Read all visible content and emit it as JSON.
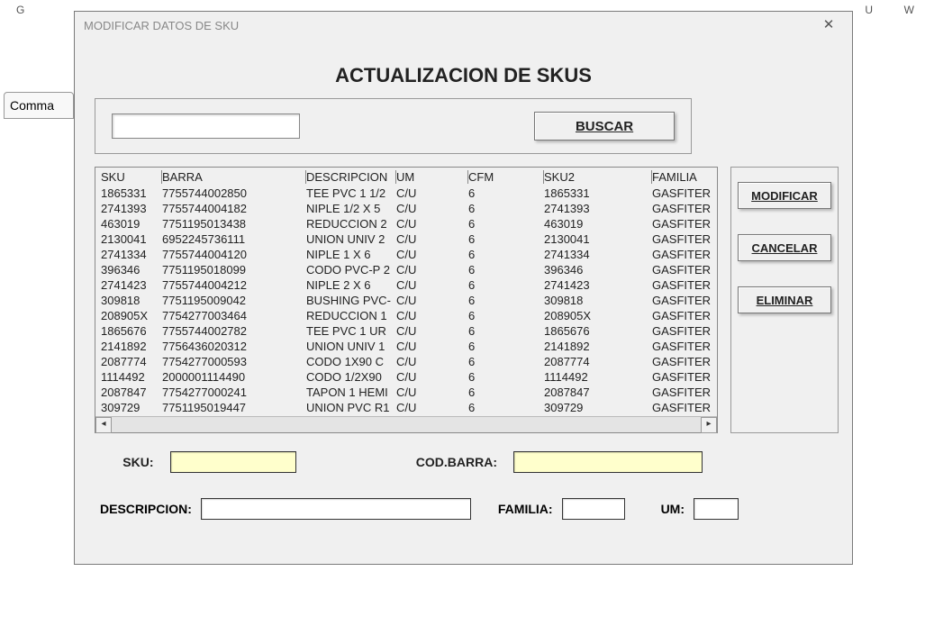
{
  "sheet": {
    "col_g": "G",
    "col_u": "U",
    "col_w": "W",
    "behind_button": "Comma"
  },
  "dialog": {
    "title": "MODIFICAR DATOS DE SKU",
    "heading": "ACTUALIZACION DE SKUS",
    "buscar": "BUSCAR",
    "side": {
      "modificar": "MODIFICAR",
      "cancelar": "CANCELAR",
      "eliminar": "ELIMINAR"
    },
    "grid": {
      "headers": {
        "sku": "SKU",
        "barra": "BARRA",
        "descripcion": "DESCRIPCION",
        "um": "UM",
        "cfm": "CFM",
        "sku2": "SKU2",
        "familia": "FAMILIA"
      },
      "rows": [
        {
          "sku": "1865331",
          "barra": "7755744002850",
          "desc": "TEE PVC 1 1/2",
          "um": "C/U",
          "cfm": "6",
          "sku2": "1865331",
          "fam": "GASFITER"
        },
        {
          "sku": "2741393",
          "barra": "7755744004182",
          "desc": "NIPLE 1/2 X 5",
          "um": "C/U",
          "cfm": "6",
          "sku2": "2741393",
          "fam": "GASFITER"
        },
        {
          "sku": "463019",
          "barra": "7751195013438",
          "desc": "REDUCCION 2",
          "um": "C/U",
          "cfm": "6",
          "sku2": "463019",
          "fam": "GASFITER"
        },
        {
          "sku": "2130041",
          "barra": "6952245736111",
          "desc": "UNION UNIV 2",
          "um": "C/U",
          "cfm": "6",
          "sku2": "2130041",
          "fam": "GASFITER"
        },
        {
          "sku": "2741334",
          "barra": "7755744004120",
          "desc": "NIPLE 1 X 6",
          "um": "C/U",
          "cfm": "6",
          "sku2": "2741334",
          "fam": "GASFITER"
        },
        {
          "sku": "396346",
          "barra": "7751195018099",
          "desc": "CODO PVC-P 2",
          "um": "C/U",
          "cfm": "6",
          "sku2": "396346",
          "fam": "GASFITER"
        },
        {
          "sku": "2741423",
          "barra": "7755744004212",
          "desc": "NIPLE 2 X 6",
          "um": "C/U",
          "cfm": "6",
          "sku2": "2741423",
          "fam": "GASFITER"
        },
        {
          "sku": "309818",
          "barra": "7751195009042",
          "desc": "BUSHING PVC-",
          "um": "C/U",
          "cfm": "6",
          "sku2": "309818",
          "fam": "GASFITER"
        },
        {
          "sku": "208905X",
          "barra": "7754277003464",
          "desc": "REDUCCION 1",
          "um": "C/U",
          "cfm": "6",
          "sku2": "208905X",
          "fam": "GASFITER"
        },
        {
          "sku": "1865676",
          "barra": "7755744002782",
          "desc": "TEE PVC 1 UR",
          "um": "C/U",
          "cfm": "6",
          "sku2": "1865676",
          "fam": "GASFITER"
        },
        {
          "sku": "2141892",
          "barra": "7756436020312",
          "desc": "UNION UNIV 1",
          "um": "C/U",
          "cfm": "6",
          "sku2": "2141892",
          "fam": "GASFITER"
        },
        {
          "sku": "2087774",
          "barra": "7754277000593",
          "desc": "CODO 1X90 C",
          "um": "C/U",
          "cfm": "6",
          "sku2": "2087774",
          "fam": "GASFITER"
        },
        {
          "sku": "1114492",
          "barra": "2000001114490",
          "desc": "CODO 1/2X90",
          "um": "C/U",
          "cfm": "6",
          "sku2": "1114492",
          "fam": "GASFITER"
        },
        {
          "sku": "2087847",
          "barra": "7754277000241",
          "desc": "TAPON 1 HEMI",
          "um": "C/U",
          "cfm": "6",
          "sku2": "2087847",
          "fam": "GASFITER"
        },
        {
          "sku": "309729",
          "barra": "7751195019447",
          "desc": "UNION PVC R1",
          "um": "C/U",
          "cfm": "6",
          "sku2": "309729",
          "fam": "GASFITER"
        }
      ]
    },
    "fields": {
      "sku_label": "SKU:",
      "codbarra_label": "COD.BARRA:",
      "descripcion_label": "DESCRIPCION:",
      "familia_label": "FAMILIA:",
      "um_label": "UM:"
    }
  }
}
